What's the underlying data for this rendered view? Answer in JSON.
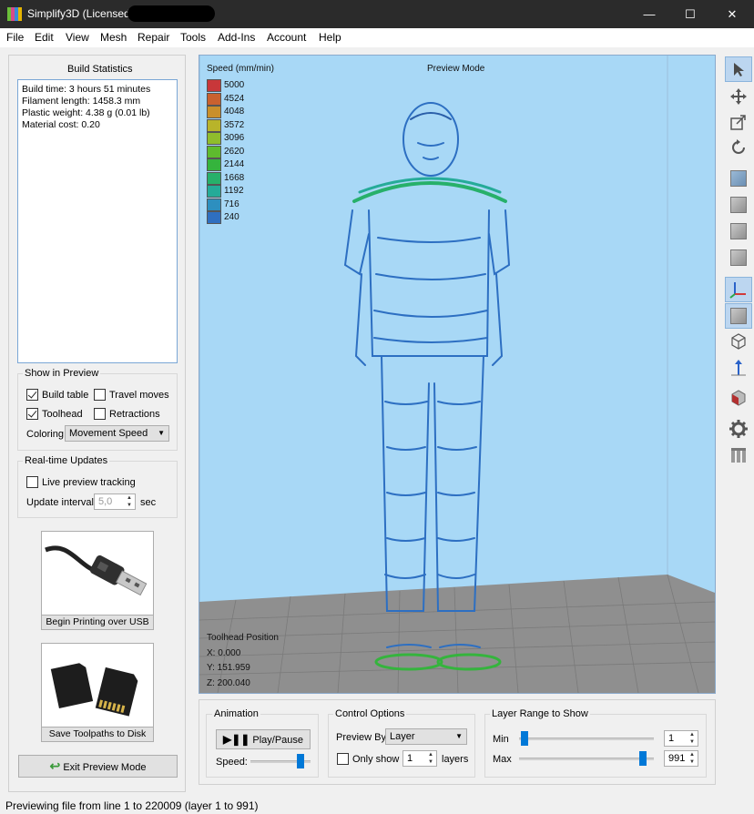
{
  "window": {
    "title": "Simplify3D (Licensed t",
    "minimize": "—",
    "maximize": "☐",
    "close": "✕"
  },
  "menu": [
    "File",
    "Edit",
    "View",
    "Mesh",
    "Repair",
    "Tools",
    "Add-Ins",
    "Account",
    "Help"
  ],
  "build_statistics": {
    "title": "Build Statistics",
    "lines": [
      "Build time: 3 hours 51 minutes",
      "Filament length: 1458.3 mm",
      "Plastic weight: 4.38 g (0.01 lb)",
      "Material cost: 0.20"
    ]
  },
  "show_in_preview": {
    "title": "Show in Preview",
    "build_table": {
      "label": "Build table",
      "checked": true
    },
    "travel_moves": {
      "label": "Travel moves",
      "checked": false
    },
    "toolhead": {
      "label": "Toolhead",
      "checked": true
    },
    "retractions": {
      "label": "Retractions",
      "checked": false
    },
    "coloring_label": "Coloring",
    "coloring_value": "Movement Speed"
  },
  "realtime_updates": {
    "title": "Real-time Updates",
    "live_tracking": {
      "label": "Live preview tracking",
      "checked": false
    },
    "update_interval_label": "Update interval",
    "update_interval_value": "5,0",
    "update_interval_unit": "sec"
  },
  "buttons": {
    "begin_printing_usb": "Begin Printing over USB",
    "save_toolpaths": "Save Toolpaths to Disk",
    "exit_preview": "Exit Preview Mode"
  },
  "viewport": {
    "mode_label": "Preview Mode",
    "legend_title": "Speed (mm/min)",
    "legend": [
      {
        "value": "5000",
        "color": "#c8373a"
      },
      {
        "value": "4524",
        "color": "#c9612f"
      },
      {
        "value": "4048",
        "color": "#c98f2b"
      },
      {
        "value": "3572",
        "color": "#b8b42a"
      },
      {
        "value": "3096",
        "color": "#8fbd2c"
      },
      {
        "value": "2620",
        "color": "#5ebb2e"
      },
      {
        "value": "2144",
        "color": "#35b43d"
      },
      {
        "value": "1668",
        "color": "#27b06a"
      },
      {
        "value": "1192",
        "color": "#25ab98"
      },
      {
        "value": "716",
        "color": "#2d8fbf"
      },
      {
        "value": "240",
        "color": "#2f6fc0"
      }
    ],
    "toolhead_position": {
      "title": "Toolhead Position",
      "x": "X: 0.000",
      "y": "Y: 151.959",
      "z": "Z: 200.040"
    }
  },
  "animation": {
    "title": "Animation",
    "play_pause": "Play/Pause",
    "speed_label": "Speed:"
  },
  "control_options": {
    "title": "Control Options",
    "preview_by_label": "Preview By",
    "preview_by_value": "Layer",
    "only_show_label": "Only show",
    "only_show_checked": false,
    "only_show_value": "1",
    "layers_label": "layers"
  },
  "layer_range": {
    "title": "Layer Range to Show",
    "min_label": "Min",
    "min_value": "1",
    "max_label": "Max",
    "max_value": "991",
    "min_fraction": 0.0,
    "max_fraction": 1.0
  },
  "status": "Previewing file from line 1 to 220009 (layer 1 to 991)",
  "right_toolbar": [
    "select-arrow-icon",
    "move-icon",
    "scale-icon",
    "rotate-icon",
    "view-cube-icon",
    "view-cube-icon",
    "view-cube-icon",
    "view-cube-icon",
    "axes-icon",
    "solid-cube-icon",
    "wireframe-cube-icon",
    "normal-arrow-icon",
    "cross-section-icon",
    "settings-gear-icon",
    "supports-icon"
  ]
}
